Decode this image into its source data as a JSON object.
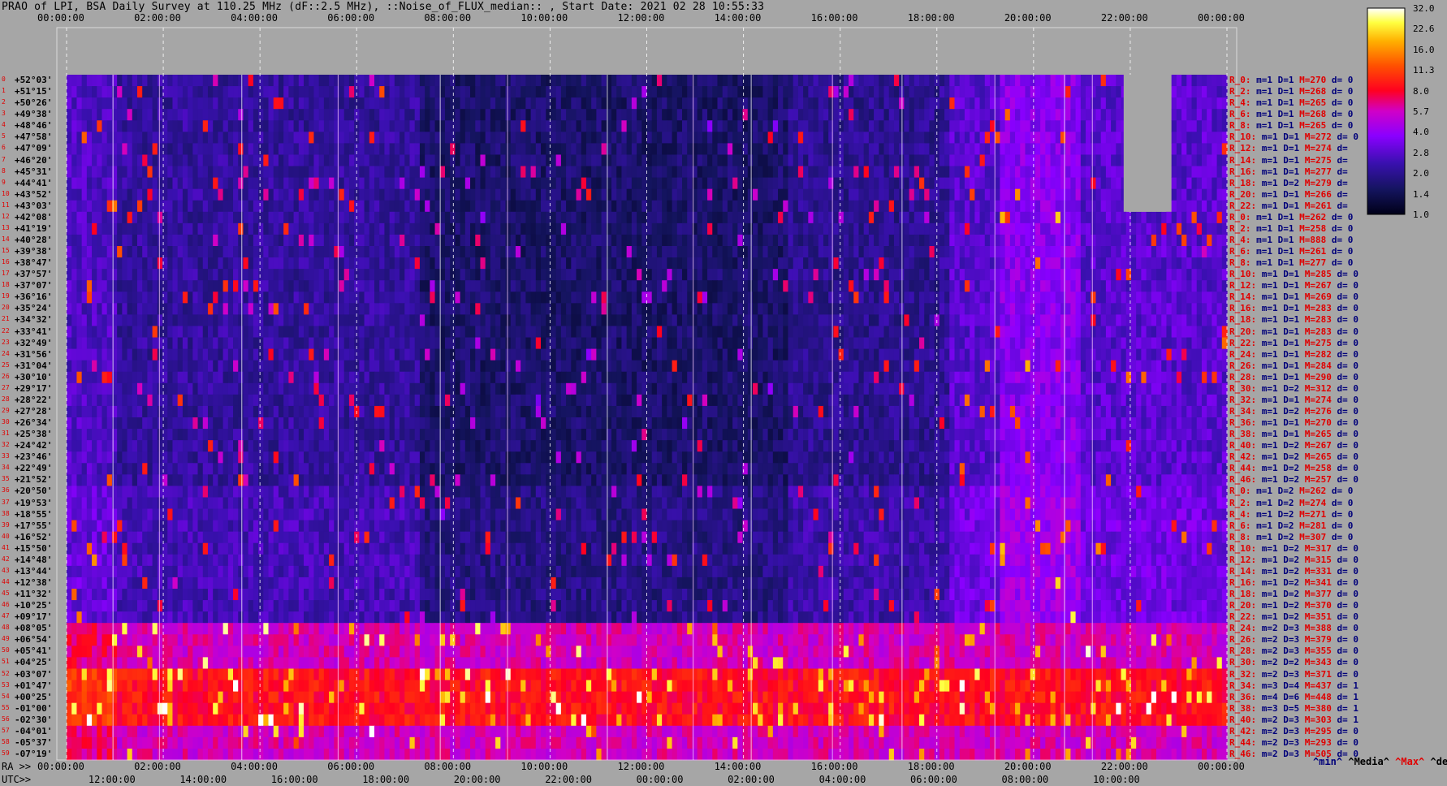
{
  "title": "PRAO of LPI, BSA Daily Survey at 110.25 MHz (dF::2.5 MHz), ::Noise_of_FLUX_median:: , Start Date: 2021 02 28 10:55:33",
  "chart_data": {
    "type": "heatmap",
    "title": "PRAO of LPI, BSA Daily Survey at 110.25 MHz (dF::2.5 MHz), ::Noise_of_FLUX_median:: , Start Date: 2021 02 28 10:55:33",
    "x_top_ticks": [
      "00:00:00",
      "02:00:00",
      "04:00:00",
      "06:00:00",
      "08:00:00",
      "10:00:00",
      "12:00:00",
      "14:00:00",
      "16:00:00",
      "18:00:00",
      "20:00:00",
      "22:00:00",
      "00:00:00"
    ],
    "x_bottom_ra_label": "RA >>",
    "x_bottom_ra_ticks": [
      "00:00:00",
      "02:00:00",
      "04:00:00",
      "06:00:00",
      "08:00:00",
      "10:00:00",
      "12:00:00",
      "14:00:00",
      "16:00:00",
      "18:00:00",
      "20:00:00",
      "22:00:00",
      "00:00:00"
    ],
    "x_bottom_utc_label": "UTC>>",
    "x_bottom_utc_ticks": [
      "12:00:00",
      "14:00:00",
      "16:00:00",
      "18:00:00",
      "20:00:00",
      "22:00:00",
      "00:00:00",
      "02:00:00",
      "04:00:00",
      "06:00:00",
      "08:00:00",
      "10:00:00"
    ],
    "declinations": [
      "+52°03'",
      "+51°15'",
      "+50°26'",
      "+49°38'",
      "+48°46'",
      "+47°58'",
      "+47°09'",
      "+46°20'",
      "+45°31'",
      "+44°41'",
      "+43°52'",
      "+43°03'",
      "+42°08'",
      "+41°19'",
      "+40°28'",
      "+39°38'",
      "+38°47'",
      "+37°57'",
      "+37°07'",
      "+36°16'",
      "+35°24'",
      "+34°32'",
      "+33°41'",
      "+32°49'",
      "+31°56'",
      "+31°04'",
      "+30°10'",
      "+29°17'",
      "+28°22'",
      "+27°28'",
      "+26°34'",
      "+25°38'",
      "+24°42'",
      "+23°46'",
      "+22°49'",
      "+21°52'",
      "+20°50'",
      "+19°53'",
      "+18°55'",
      "+17°55'",
      "+16°52'",
      "+15°50'",
      "+14°48'",
      "+13°44'",
      "+12°38'",
      "+11°32'",
      "+10°25'",
      "+09°17'",
      "+08°05'",
      "+06°54'",
      "+05°41'",
      "+04°25'",
      "+03°07'",
      "+01°47'",
      "+00°25'",
      "-01°00'",
      "-02°30'",
      "-04°01'",
      "-05°37'",
      "-07°19'"
    ],
    "row_info": [
      [
        "R_0:",
        "m=1",
        "D=1",
        "M=270",
        "d= 0"
      ],
      [
        "R_2:",
        "m=1",
        "D=1",
        "M=268",
        "d= 0"
      ],
      [
        "R_4:",
        "m=1",
        "D=1",
        "M=265",
        "d= 0"
      ],
      [
        "R_6:",
        "m=1",
        "D=1",
        "M=268",
        "d= 0"
      ],
      [
        "R_8:",
        "m=1",
        "D=1",
        "M=265",
        "d= 0"
      ],
      [
        "R_10:",
        "m=1",
        "D=1",
        "M=272",
        "d= 0"
      ],
      [
        "R_12:",
        "m=1",
        "D=1",
        "M=274",
        "d="
      ],
      [
        "R_14:",
        "m=1",
        "D=1",
        "M=275",
        "d="
      ],
      [
        "R_16:",
        "m=1",
        "D=1",
        "M=277",
        "d="
      ],
      [
        "R_18:",
        "m=1",
        "D=2",
        "M=279",
        "d="
      ],
      [
        "R_20:",
        "m=1",
        "D=1",
        "M=266",
        "d="
      ],
      [
        "R_22:",
        "m=1",
        "D=1",
        "M=261",
        "d="
      ],
      [
        "R_0:",
        "m=1",
        "D=1",
        "M=262",
        "d= 0"
      ],
      [
        "R_2:",
        "m=1",
        "D=1",
        "M=258",
        "d= 0"
      ],
      [
        "R_4:",
        "m=1",
        "D=1",
        "M=888",
        "d= 0"
      ],
      [
        "R_6:",
        "m=1",
        "D=1",
        "M=261",
        "d= 0"
      ],
      [
        "R_8:",
        "m=1",
        "D=1",
        "M=277",
        "d= 0"
      ],
      [
        "R_10:",
        "m=1",
        "D=1",
        "M=285",
        "d= 0"
      ],
      [
        "R_12:",
        "m=1",
        "D=1",
        "M=267",
        "d= 0"
      ],
      [
        "R_14:",
        "m=1",
        "D=1",
        "M=269",
        "d= 0"
      ],
      [
        "R_16:",
        "m=1",
        "D=1",
        "M=283",
        "d= 0"
      ],
      [
        "R_18:",
        "m=1",
        "D=1",
        "M=283",
        "d= 0"
      ],
      [
        "R_20:",
        "m=1",
        "D=1",
        "M=283",
        "d= 0"
      ],
      [
        "R_22:",
        "m=1",
        "D=1",
        "M=275",
        "d= 0"
      ],
      [
        "R_24:",
        "m=1",
        "D=1",
        "M=282",
        "d= 0"
      ],
      [
        "R_26:",
        "m=1",
        "D=1",
        "M=284",
        "d= 0"
      ],
      [
        "R_28:",
        "m=1",
        "D=1",
        "M=290",
        "d= 0"
      ],
      [
        "R_30:",
        "m=1",
        "D=2",
        "M=312",
        "d= 0"
      ],
      [
        "R_32:",
        "m=1",
        "D=1",
        "M=274",
        "d= 0"
      ],
      [
        "R_34:",
        "m=1",
        "D=2",
        "M=276",
        "d= 0"
      ],
      [
        "R_36:",
        "m=1",
        "D=1",
        "M=270",
        "d= 0"
      ],
      [
        "R_38:",
        "m=1",
        "D=1",
        "M=265",
        "d= 0"
      ],
      [
        "R_40:",
        "m=1",
        "D=2",
        "M=267",
        "d= 0"
      ],
      [
        "R_42:",
        "m=1",
        "D=2",
        "M=265",
        "d= 0"
      ],
      [
        "R_44:",
        "m=1",
        "D=2",
        "M=258",
        "d= 0"
      ],
      [
        "R_46:",
        "m=1",
        "D=2",
        "M=257",
        "d= 0"
      ],
      [
        "R_0:",
        "m=1",
        "D=2",
        "M=262",
        "d= 0"
      ],
      [
        "R_2:",
        "m=1",
        "D=2",
        "M=274",
        "d= 0"
      ],
      [
        "R_4:",
        "m=1",
        "D=2",
        "M=271",
        "d= 0"
      ],
      [
        "R_6:",
        "m=1",
        "D=2",
        "M=281",
        "d= 0"
      ],
      [
        "R_8:",
        "m=1",
        "D=2",
        "M=307",
        "d= 0"
      ],
      [
        "R_10:",
        "m=1",
        "D=2",
        "M=317",
        "d= 0"
      ],
      [
        "R_12:",
        "m=1",
        "D=2",
        "M=315",
        "d= 0"
      ],
      [
        "R_14:",
        "m=1",
        "D=2",
        "M=331",
        "d= 0"
      ],
      [
        "R_16:",
        "m=1",
        "D=2",
        "M=341",
        "d= 0"
      ],
      [
        "R_18:",
        "m=1",
        "D=2",
        "M=377",
        "d= 0"
      ],
      [
        "R_20:",
        "m=1",
        "D=2",
        "M=370",
        "d= 0"
      ],
      [
        "R_22:",
        "m=1",
        "D=2",
        "M=351",
        "d= 0"
      ],
      [
        "R_24:",
        "m=2",
        "D=3",
        "M=388",
        "d= 0"
      ],
      [
        "R_26:",
        "m=2",
        "D=3",
        "M=379",
        "d= 0"
      ],
      [
        "R_28:",
        "m=2",
        "D=3",
        "M=355",
        "d= 0"
      ],
      [
        "R_30:",
        "m=2",
        "D=2",
        "M=343",
        "d= 0"
      ],
      [
        "R_32:",
        "m=2",
        "D=3",
        "M=371",
        "d= 0"
      ],
      [
        "R_34:",
        "m=3",
        "D=4",
        "M=437",
        "d= 1"
      ],
      [
        "R_36:",
        "m=4",
        "D=6",
        "M=448",
        "d= 1"
      ],
      [
        "R_38:",
        "m=3",
        "D=5",
        "M=380",
        "d= 1"
      ],
      [
        "R_40:",
        "m=2",
        "D=3",
        "M=303",
        "d= 1"
      ],
      [
        "R_42:",
        "m=2",
        "D=3",
        "M=295",
        "d= 0"
      ],
      [
        "R_44:",
        "m=2",
        "D=3",
        "M=293",
        "d= 0"
      ],
      [
        "R_46:",
        "m=2",
        "D=3",
        "M=505",
        "d= 0"
      ]
    ],
    "colorbar_ticks": [
      "32.0",
      "22.6",
      "16.0",
      "11.3",
      "8.0",
      "5.7",
      "4.0",
      "2.8",
      "2.0",
      "1.4",
      "1.0"
    ],
    "colorbar_scale": "log",
    "colorbar_range": [
      1.0,
      32.0
    ],
    "footer_legend": [
      {
        "text": "^min^",
        "color": "#00007a"
      },
      {
        "text": "^Media^",
        "color": "#000000"
      },
      {
        "text": "^Max^",
        "color": "#e00000"
      },
      {
        "text": "^devia^",
        "color": "#000000"
      }
    ]
  }
}
